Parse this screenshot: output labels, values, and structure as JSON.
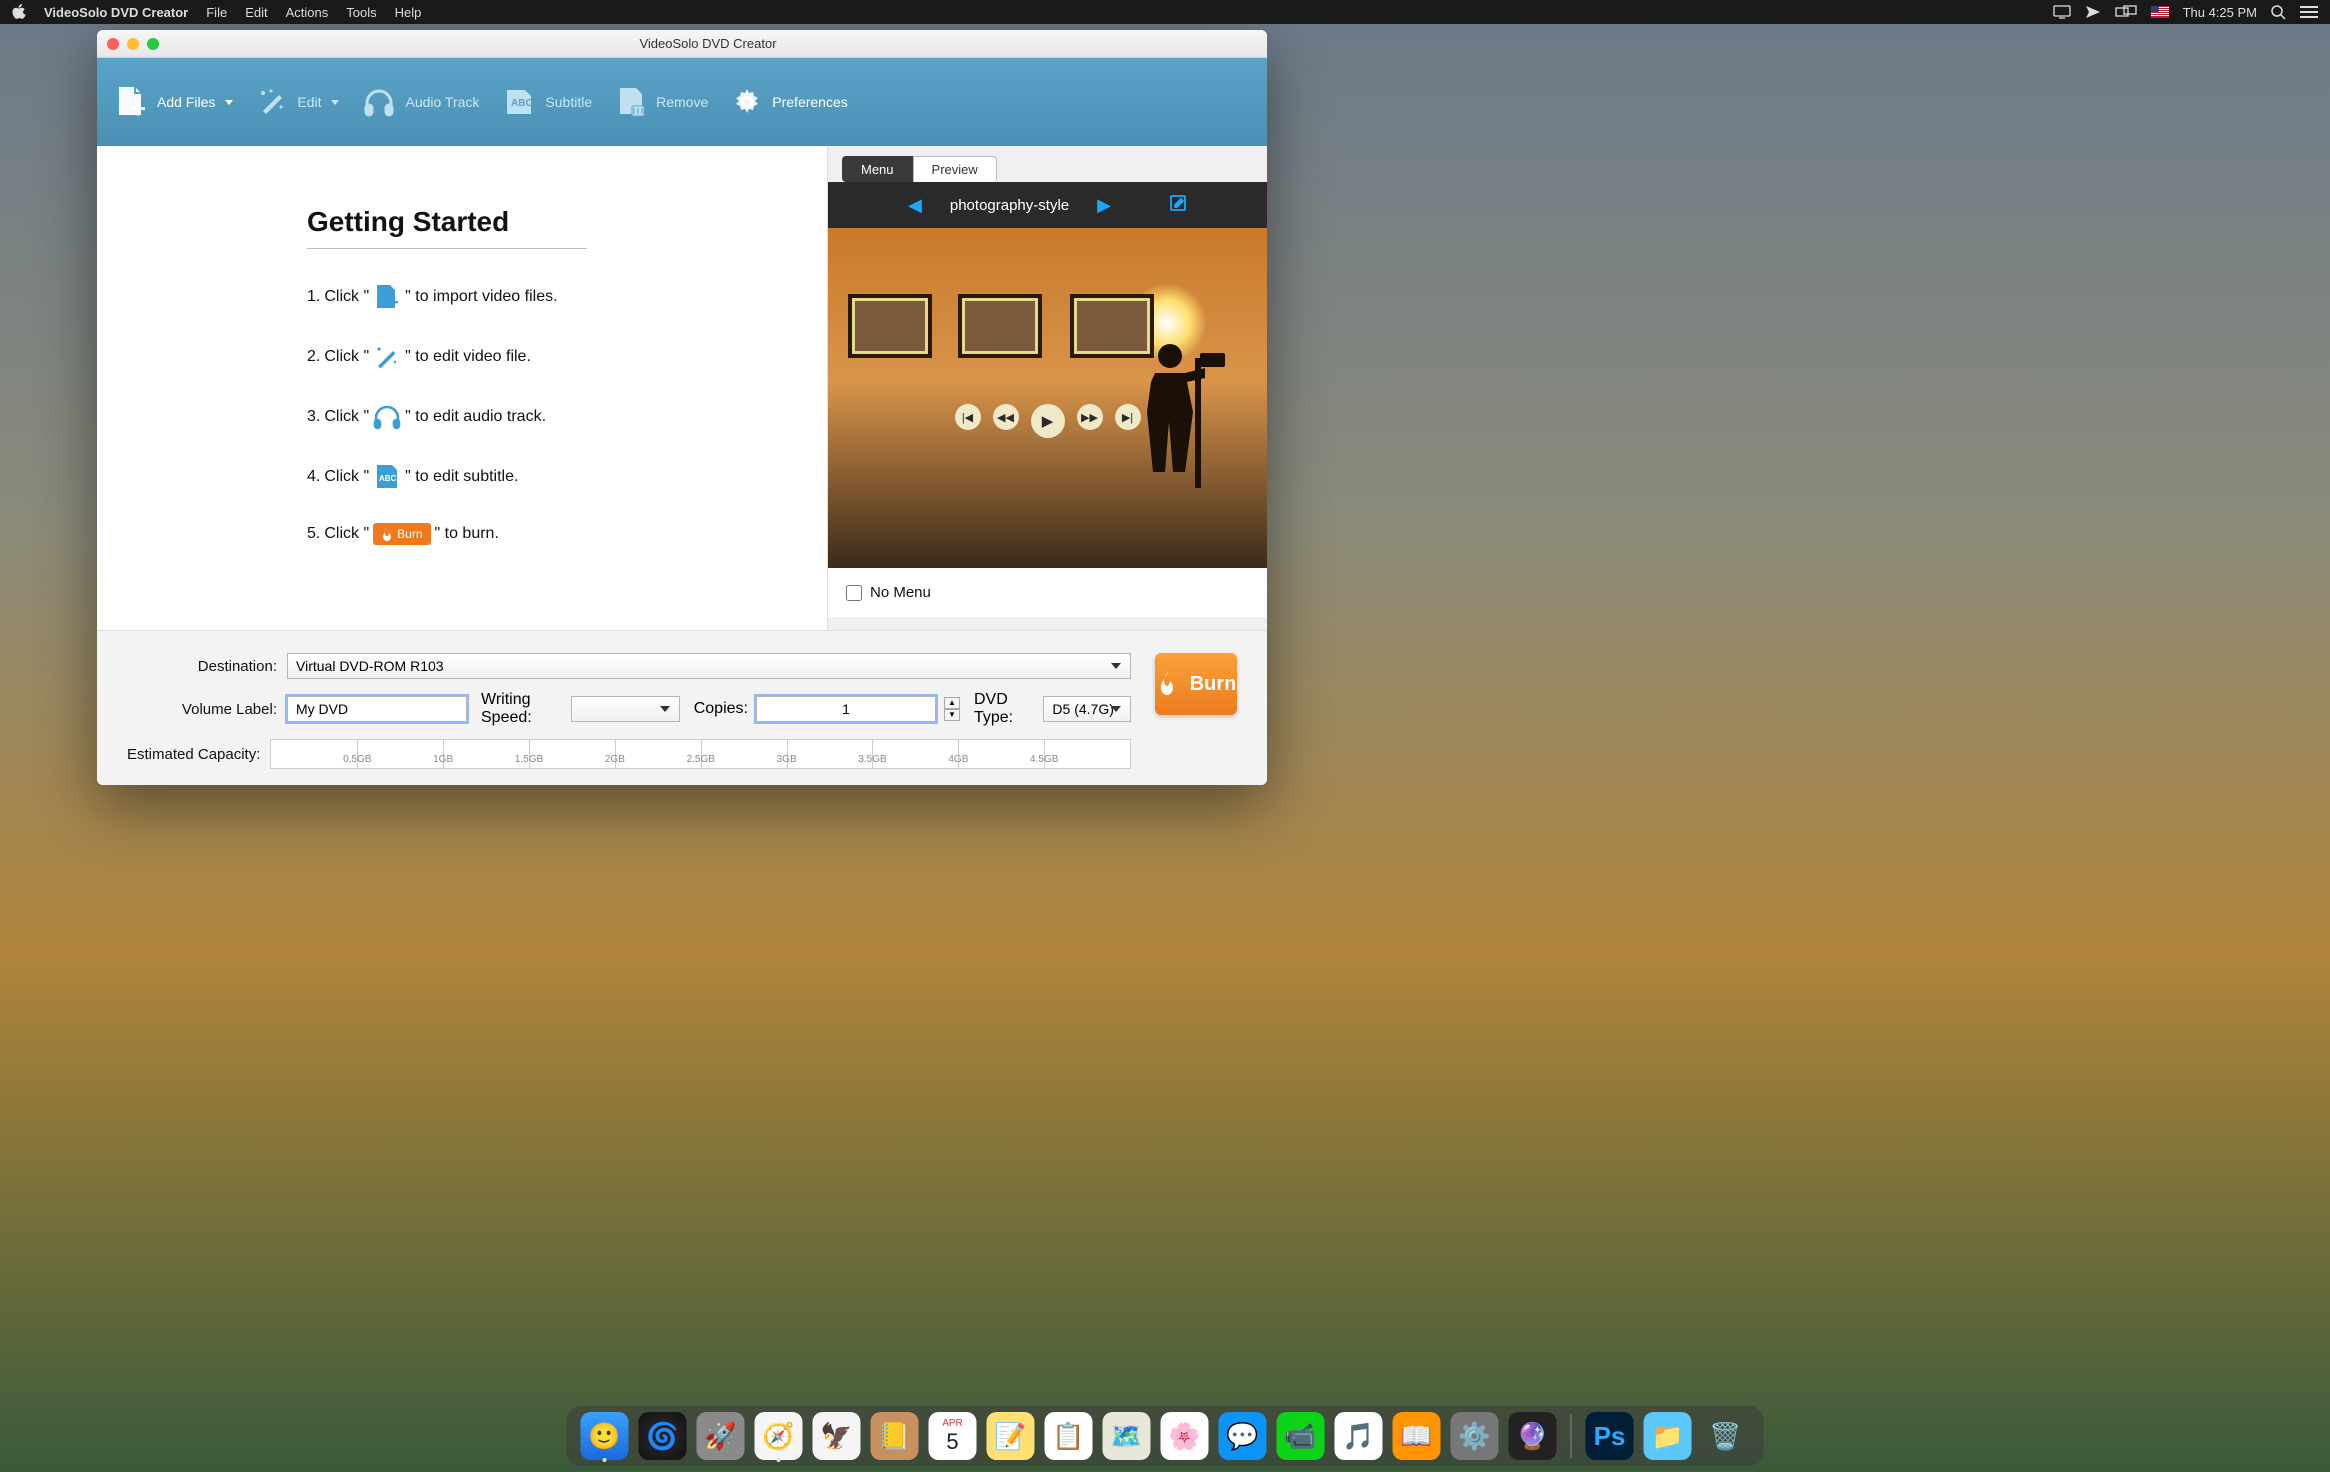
{
  "menubar": {
    "app": "VideoSolo DVD Creator",
    "items": [
      "File",
      "Edit",
      "Actions",
      "Tools",
      "Help"
    ],
    "clock": "Thu 4:25 PM"
  },
  "window": {
    "title": "VideoSolo DVD Creator"
  },
  "toolbar": {
    "add_files": "Add Files",
    "edit": "Edit",
    "audio_track": "Audio Track",
    "subtitle": "Subtitle",
    "remove": "Remove",
    "preferences": "Preferences"
  },
  "getting_started": {
    "heading": "Getting Started",
    "steps": [
      {
        "n": "1.",
        "pre": "Click \"",
        "post": "\" to import video files."
      },
      {
        "n": "2.",
        "pre": "Click \"",
        "post": "\" to edit video file."
      },
      {
        "n": "3.",
        "pre": "Click \"",
        "post": "\" to edit audio track."
      },
      {
        "n": "4.",
        "pre": "Click \"",
        "post": "\" to edit subtitle."
      },
      {
        "n": "5.",
        "pre": "Click \"",
        "post": "\" to burn.",
        "chip": "Burn"
      }
    ]
  },
  "right": {
    "tabs": {
      "menu": "Menu",
      "preview": "Preview"
    },
    "style": "photography-style",
    "no_menu": "No Menu"
  },
  "bottom": {
    "destination_label": "Destination:",
    "destination_value": "Virtual DVD-ROM R103",
    "volume_label_label": "Volume Label:",
    "volume_label_value": "My DVD",
    "writing_speed_label": "Writing Speed:",
    "writing_speed_value": "",
    "copies_label": "Copies:",
    "copies_value": "1",
    "dvd_type_label": "DVD Type:",
    "dvd_type_value": "D5 (4.7G)",
    "capacity_label": "Estimated Capacity:",
    "capacity_ticks": [
      "0.5GB",
      "1GB",
      "1.5GB",
      "2GB",
      "2.5GB",
      "3GB",
      "3.5GB",
      "4GB",
      "4.5GB"
    ],
    "burn_btn": "Burn"
  },
  "dock": {
    "ps": "Ps",
    "cal_day": "5",
    "cal_mon": "APR"
  }
}
